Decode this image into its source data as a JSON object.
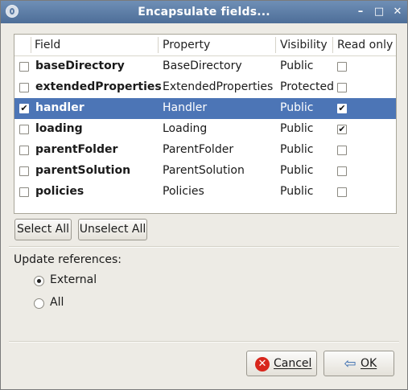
{
  "window": {
    "title": "Encapsulate fields...",
    "minimize_glyph": "–",
    "maximize_glyph": "□",
    "close_glyph": "✕"
  },
  "table": {
    "headers": {
      "field": "Field",
      "property": "Property",
      "visibility": "Visibility",
      "read_only": "Read only"
    },
    "rows": [
      {
        "field": "baseDirectory",
        "property": "BaseDirectory",
        "visibility": "Public",
        "checked": false,
        "read_only": false,
        "selected": false
      },
      {
        "field": "extendedProperties",
        "property": "ExtendedProperties",
        "visibility": "Protected",
        "checked": false,
        "read_only": false,
        "selected": false
      },
      {
        "field": "handler",
        "property": "Handler",
        "visibility": "Public",
        "checked": true,
        "read_only": true,
        "selected": true
      },
      {
        "field": "loading",
        "property": "Loading",
        "visibility": "Public",
        "checked": false,
        "read_only": true,
        "selected": false
      },
      {
        "field": "parentFolder",
        "property": "ParentFolder",
        "visibility": "Public",
        "checked": false,
        "read_only": false,
        "selected": false
      },
      {
        "field": "parentSolution",
        "property": "ParentSolution",
        "visibility": "Public",
        "checked": false,
        "read_only": false,
        "selected": false
      },
      {
        "field": "policies",
        "property": "Policies",
        "visibility": "Public",
        "checked": false,
        "read_only": false,
        "selected": false
      }
    ]
  },
  "buttons": {
    "select_all": "Select All",
    "unselect_all": "Unselect All",
    "cancel": "Cancel",
    "ok": "OK"
  },
  "update_references": {
    "label": "Update references:",
    "options": [
      {
        "label": "External",
        "selected": true
      },
      {
        "label": "All",
        "selected": false
      }
    ]
  },
  "colors": {
    "title_bar": "#5a7aa3",
    "selection": "#4c75b6"
  },
  "icons": {
    "cancel": "cancel-icon",
    "ok": "ok-arrow-icon"
  }
}
